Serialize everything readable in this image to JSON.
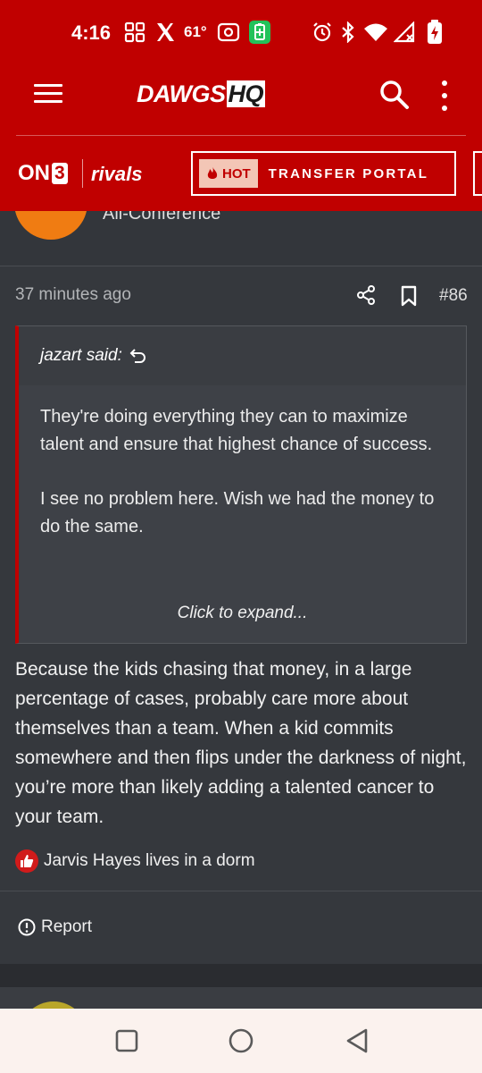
{
  "status_bar": {
    "time": "4:16",
    "temperature": "61°",
    "icons": [
      "grid-icon",
      "x-logo-icon",
      "weather-icon",
      "screen-record-icon",
      "battery-saver-icon",
      "alarm-icon",
      "bluetooth-icon",
      "wifi-icon",
      "signal-icon",
      "battery-charging-icon"
    ]
  },
  "header": {
    "logo_main": "DAWGS",
    "logo_accent": "HQ",
    "menu_icon": "hamburger-icon",
    "search_icon": "search-icon",
    "more_icon": "more-vertical-icon"
  },
  "partner_bar": {
    "on3_prefix": "ON",
    "on3_digit": "3",
    "rivals": "rivals",
    "hot_label": "HOT",
    "portal_label": "TRANSFER PORTAL"
  },
  "previous_post": {
    "role": "All-Conference"
  },
  "post": {
    "timestamp": "37 minutes ago",
    "number": "#86",
    "quote": {
      "author": "jazart said:",
      "paragraphs": [
        "They're doing everything they can to maximize talent and ensure that highest chance of success.",
        "I see no problem here. Wish we had the money to do the same."
      ],
      "expand_label": "Click to expand..."
    },
    "body": "Because the kids chasing that money, in a large percentage of cases, probably care more about themselves than a team. When a kid commits somewhere and then flips under the darkness of night, you’re more than likely adding a talented cancer to your team.",
    "reaction_text": "Jarvis Hayes lives in a dorm",
    "report_label": "Report"
  },
  "colors": {
    "brand_red": "#c00000",
    "background": "#2d3035",
    "post_bg": "#35383d"
  }
}
